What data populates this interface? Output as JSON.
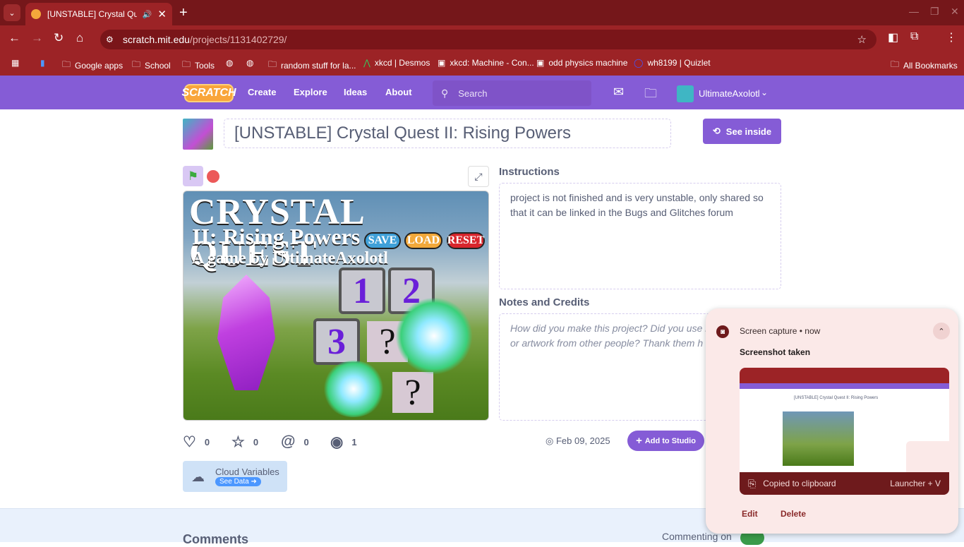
{
  "browser": {
    "tab": {
      "title": "[UNSTABLE] Crystal Quest II: Rising Powers",
      "close": "✕"
    },
    "new_tab": "+",
    "url": {
      "host": "scratch.mit.edu",
      "path": "/projects/1131402729/"
    },
    "bookmarks": [
      {
        "label": "",
        "icon": "google-apps-icon"
      },
      {
        "label": "Google apps",
        "icon": "folder-icon"
      },
      {
        "label": "School",
        "icon": "folder-icon"
      },
      {
        "label": "Tools",
        "icon": "folder-icon"
      },
      {
        "label": "",
        "icon": "globe-icon"
      },
      {
        "label": "",
        "icon": "globe-icon"
      },
      {
        "label": "random stuff for la...",
        "icon": "folder-icon"
      },
      {
        "label": "xkcd | Desmos",
        "icon": "desmos-icon"
      },
      {
        "label": "xkcd: Machine - Con...",
        "icon": "xkcd-icon"
      },
      {
        "label": "odd physics machine",
        "icon": "xkcd-icon"
      },
      {
        "label": "wh8199 | Quizlet",
        "icon": "quizlet-icon"
      }
    ],
    "all_bookmarks": "All Bookmarks"
  },
  "scratch_nav": {
    "logo": "SCRATCH",
    "links": [
      "Create",
      "Explore",
      "Ideas",
      "About"
    ],
    "search_placeholder": "Search",
    "username": "UltimateAxolotl"
  },
  "project": {
    "title": "[UNSTABLE] Crystal Quest II: Rising Powers",
    "see_inside": "See inside",
    "stage": {
      "title": "CRYSTAL QUEST",
      "subtitle": "II: Rising Powers",
      "byline": "A game by UltimateAxolotl",
      "buttons": [
        "SAVE",
        "LOAD",
        "RESET"
      ],
      "slots": [
        "1",
        "2",
        "3"
      ],
      "unknown": "?"
    },
    "instructions_heading": "Instructions",
    "instructions": "project is not finished and is very unstable, only shared so that it can be linked in the Bugs and Glitches forum",
    "notes_heading": "Notes and Credits",
    "notes_placeholder": "How did you make this project? Did you use ideas, scripts or artwork from other people? Thank them h",
    "stats": {
      "loves": "0",
      "favorites": "0",
      "remixes": "0",
      "views": "1"
    },
    "date": "Feb 09, 2025",
    "add_to_studio": "Add to Studio",
    "cloud_variables": "Cloud Variables",
    "see_data": "See Data"
  },
  "comments": {
    "heading": "Comments",
    "commenting_on": "Commenting on"
  },
  "notification": {
    "source": "Screen capture",
    "time": "now",
    "heading": "Screenshot taken",
    "preview_title": "[UNSTABLE] Crystal Quest II: Rising Powers",
    "clipboard": "Copied to clipboard",
    "shortcut": "Launcher + V",
    "actions": [
      "Edit",
      "Delete"
    ]
  },
  "colors": {
    "scratch_purple": "#855cd6",
    "chrome_red": "#9c2326",
    "titlebar": "#75171a"
  }
}
